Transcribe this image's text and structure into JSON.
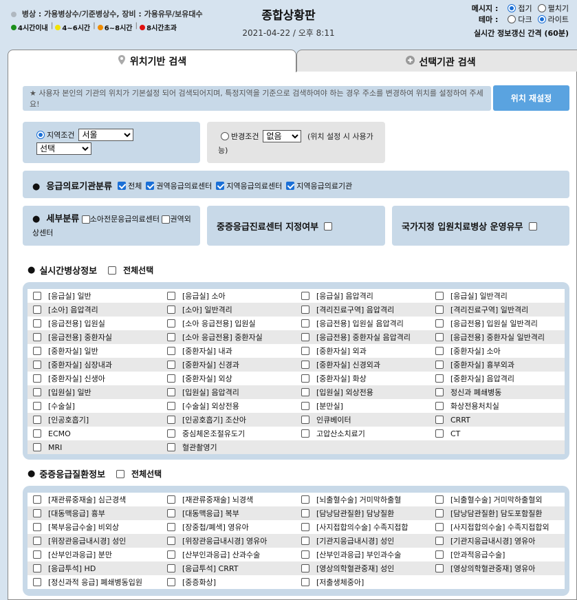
{
  "header": {
    "legend_label": "병상 : 가용병상수/기준병상수, 장비 : 가용유무/보유대수",
    "legend_items": [
      {
        "label": "4시간이내",
        "color": "#1a8f1a"
      },
      {
        "label": "4~6시간",
        "color": "#f2e200"
      },
      {
        "label": "6~8시간",
        "color": "#f08c00"
      },
      {
        "label": "8시간초과",
        "color": "#e01010"
      }
    ],
    "title": "종합상황판",
    "datetime": "2021-04-22 / 오후 8:11",
    "message_label": "메시지 :",
    "message_opts": [
      "접기",
      "펼치기"
    ],
    "theme_label": "테마 :",
    "theme_opts": [
      "다크",
      "라이트"
    ],
    "interval_text": "실시간 정보갱신 간격 (60분)"
  },
  "tabs": {
    "location": "위치기반 검색",
    "selected": "선택기관 검색"
  },
  "notice": {
    "text": "★ 사용자 본인의 기관의 위치가 기본설정 되어 검색되어지며, 특정지역을 기준으로 검색하여야 하는 경우 주소를 변경하여 위치를 설정하여 주세요!",
    "reset_label": "위치 재설정"
  },
  "region": {
    "label": "지역조건",
    "city": "서울",
    "district": "선택"
  },
  "radius": {
    "label": "반경조건",
    "value": "없음",
    "note": "(위치 설정 시 사용가능)"
  },
  "category": {
    "title": "응급의료기관분류",
    "items": [
      "전체",
      "권역응급의료센터",
      "지역응급의료센터",
      "지역응급의료기관"
    ]
  },
  "detail": {
    "title": "세부분류",
    "items": [
      "소아전문응급의료센터",
      "권역외상센터"
    ]
  },
  "severe_center": {
    "label": "중증응급진료센터 지정여부"
  },
  "national_bed": {
    "label": "국가지정 입원치료병상 운영유무"
  },
  "realtime": {
    "title": "실시간병상정보",
    "select_all": "전체선택",
    "rows": [
      [
        "[응급실] 일반",
        "[응급실] 소아",
        "[응급실] 음압격리",
        "[응급실] 일반격리"
      ],
      [
        "[소아] 음압격리",
        "[소아] 일반격리",
        "[격리진료구역] 음압격리",
        "[격리진료구역] 일반격리"
      ],
      [
        "[응급전용] 입원실",
        "[소아 응급전용] 입원실",
        "[응급전용] 입원실 음압격리",
        "[응급전용] 입원실 일반격리"
      ],
      [
        "[응급전용] 중환자실",
        "[소아 응급전용] 중환자실",
        "[응급전용] 중환자실 음압격리",
        "[응급전용] 중환자실 일반격리"
      ],
      [
        "[중환자실] 일반",
        "[중환자실] 내과",
        "[중환자실] 외과",
        "[중환자실] 소아"
      ],
      [
        "[중환자실] 심장내과",
        "[중환자실] 신경과",
        "[중환자실] 신경외과",
        "[중환자실] 흉부외과"
      ],
      [
        "[중환자실] 신생아",
        "[중환자실] 외상",
        "[중환자실] 화상",
        "[중환자실] 음압격리"
      ],
      [
        "[입원실] 일반",
        "[입원실] 음압격리",
        "[입원실] 외상전용",
        "정신과 폐쇄병동"
      ],
      [
        "[수술실]",
        "[수술실] 외상전용",
        "[분만실]",
        "화상전용처치실"
      ],
      [
        "[인공호흡기]",
        "[인공호흡기] 조산아",
        "인큐베이터",
        "CRRT"
      ],
      [
        "ECMO",
        "중심체온조절유도기",
        "고압산소치료기",
        "CT"
      ],
      [
        "MRI",
        "혈관촬영기",
        "",
        ""
      ]
    ]
  },
  "severe": {
    "title": "중증응급질환정보",
    "select_all": "전체선택",
    "rows": [
      [
        "[재관류중재술] 심근경색",
        "[재관류중재술] 뇌경색",
        "[뇌출혈수술] 거미막하출혈",
        "[뇌출혈수술] 거미막하출혈외"
      ],
      [
        "[대동맥응급] 흉부",
        "[대동맥응급] 복부",
        "[담낭담관질환] 담낭질환",
        "[담낭담관질환] 담도포함질환"
      ],
      [
        "[복부응급수술] 비외상",
        "[장중첩/폐색] 영유아",
        "[사지접합의수술] 수족지접합",
        "[사지접합의수술] 수족지접합외"
      ],
      [
        "[위장관응급내시경] 성인",
        "[위장관응급내시경] 영유아",
        "[기관지응급내시경] 성인",
        "[기관지응급내시경] 영유아"
      ],
      [
        "[산부인과응급] 분만",
        "[산부인과응급] 산과수술",
        "[산부인과응급] 부인과수술",
        "[안과적응급수술]"
      ],
      [
        "[응급투석] HD",
        "[응급투석] CRRT",
        "[영상의학혈관중재] 성인",
        "[영상의학혈관중재] 영유아"
      ],
      [
        "[정신과적 응급] 폐쇄병동입원",
        "[중증화상]",
        "[저출생체중아]",
        ""
      ]
    ]
  },
  "colors": {
    "panel_bg": "#c8d9e8",
    "accent": "#5aa3e0",
    "check": "#1a6fd6"
  }
}
